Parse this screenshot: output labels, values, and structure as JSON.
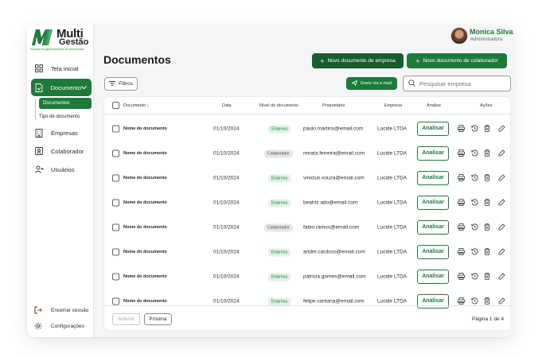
{
  "brand": {
    "logo_line1": "Multi",
    "logo_line2": "Gestão",
    "tagline": "Solução em gerenciamento de documentos",
    "accent": "#1d7a3b"
  },
  "user": {
    "name": "Monica Silva",
    "role": "Administradora"
  },
  "sidebar": {
    "items": [
      {
        "label": "Tela inicial",
        "icon": "grid-icon"
      },
      {
        "label": "Documento",
        "icon": "document-icon",
        "active": true
      },
      {
        "label": "Empresas",
        "icon": "building-icon"
      },
      {
        "label": "Colaborador",
        "icon": "id-card-icon"
      },
      {
        "label": "Usuários",
        "icon": "user-add-icon"
      }
    ],
    "subitems": [
      {
        "label": "Documentos",
        "active": true
      },
      {
        "label": "Tipo de documento"
      }
    ],
    "bottom": [
      {
        "label": "Encerrar cessão",
        "icon": "logout-icon"
      },
      {
        "label": "Configurações",
        "icon": "gear-icon"
      }
    ]
  },
  "page": {
    "title": "Documentos"
  },
  "toolbar": {
    "new_company_doc": "Novo documento de empresa",
    "new_collab_doc": "Novo documento de colaborador",
    "filters": "Filtros",
    "send_email": "Envio via e-mail",
    "search_placeholder": "Pesquisar empresa"
  },
  "table": {
    "headers": {
      "document": "Documento",
      "date": "Data",
      "level": "Nível do documento",
      "owner": "Proprietário",
      "company": "Empresa",
      "analysis": "Analise",
      "actions": "Ações"
    },
    "analyze_label": "Analisar",
    "rows": [
      {
        "name": "Nome do documento",
        "date": "01/10/2024",
        "level": "Empresa",
        "owner": "paulo.martins@email.com",
        "company": "Lucide LTDA"
      },
      {
        "name": "Nome do documento",
        "date": "01/10/2024",
        "level": "Colaborador",
        "owner": "renata.ferreira@email.com",
        "company": "Lucide LTDA"
      },
      {
        "name": "Nome do documento",
        "date": "01/10/2024",
        "level": "Empresa",
        "owner": "vinicius.souza@email.com",
        "company": "Lucide LTDA"
      },
      {
        "name": "Nome do documento",
        "date": "01/10/2024",
        "level": "Empresa",
        "owner": "beatriz.ado@email.com",
        "company": "Lucide LTDA"
      },
      {
        "name": "Nome do documento",
        "date": "01/10/2024",
        "level": "Colaborador",
        "owner": "fabio.ramos@email.com",
        "company": "Lucide LTDA"
      },
      {
        "name": "Nome do documento",
        "date": "01/10/2024",
        "level": "Empresa",
        "owner": "andre.cardoso@email.com",
        "company": "Lucide LTDA"
      },
      {
        "name": "Nome do documento",
        "date": "01/10/2024",
        "level": "Empresa",
        "owner": "patricia.gomes@email.com",
        "company": "Lucide LTDA"
      },
      {
        "name": "Nome do documento",
        "date": "01/10/2024",
        "level": "Empresa",
        "owner": "felipe.santana@email.com",
        "company": "Lucide LTDA"
      }
    ]
  },
  "pagination": {
    "prev": "Anterior",
    "next": "Próxima",
    "info": "Página 1 de 4"
  }
}
